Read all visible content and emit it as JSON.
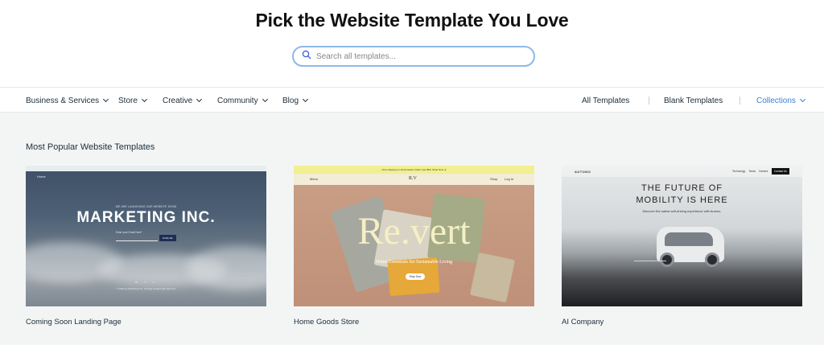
{
  "hero": {
    "title": "Pick the Website Template You Love",
    "search_placeholder": "Search all templates..."
  },
  "nav": {
    "categories": [
      {
        "label": "Business & Services"
      },
      {
        "label": "Store"
      },
      {
        "label": "Creative"
      },
      {
        "label": "Community"
      },
      {
        "label": "Blog"
      }
    ],
    "right_links": [
      {
        "label": "All Templates"
      },
      {
        "label": "Blank Templates"
      },
      {
        "label": "Collections"
      }
    ]
  },
  "colors": {
    "accent": "#3b7fd8",
    "page_bg": "#f3f5f5",
    "search_border": "#8fb8e8"
  },
  "section": {
    "title": "Most Popular Website Templates"
  },
  "cards": [
    {
      "name": "Coming Soon Landing Page",
      "preview": {
        "home_link": "Home",
        "tagline": "WE ARE LAUNCHING OUR WEBSITE SOON",
        "headline": "MARKETING INC.",
        "email_label": "Enter your Email Here*",
        "button": "Notify Me",
        "social": [
          "in",
          "f",
          "t"
        ],
        "footer": "© 2023 by Marketing Inc. Proudly created with Wix.com"
      }
    },
    {
      "name": "Home Goods Store",
      "preview": {
        "announcement": "Free shipping on all domestic orders over $50. Shop Now ➜",
        "menu": "Menu",
        "logo": "R.V",
        "shop_link": "Shop",
        "login": "Log In",
        "headline": "Re.vert",
        "subtitle": "Home Essentials for Sustainable Living",
        "button": "Shop Now"
      }
    },
    {
      "name": "AI Company",
      "preview": {
        "logo": "AUTONO",
        "nav": [
          "Technology",
          "News",
          "Careers"
        ],
        "cta": "Contact Us",
        "headline_line1": "THE FUTURE OF",
        "headline_line2": "MOBILITY IS HERE",
        "subtitle": "Discover the safest self-driving experience with Autono."
      }
    }
  ]
}
